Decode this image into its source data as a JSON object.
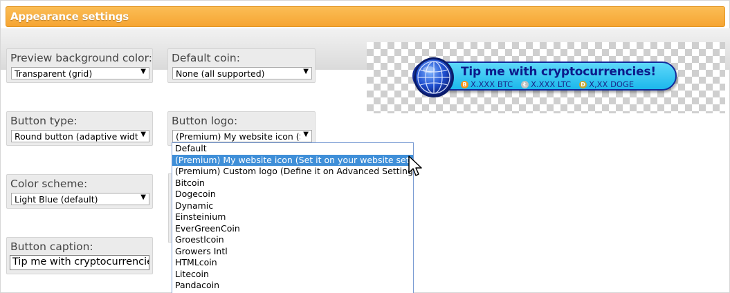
{
  "header": {
    "title": "Appearance settings"
  },
  "fields": {
    "preview_bg": {
      "label": "Preview background color:",
      "value": "Transparent (grid)"
    },
    "default_coin": {
      "label": "Default coin:",
      "value": "None (all supported)"
    },
    "button_type": {
      "label": "Button type:",
      "value": "Round button (adaptive width)"
    },
    "button_logo": {
      "label": "Button logo:",
      "value": "(Premium) My website icon (S"
    },
    "color_scheme": {
      "label": "Color scheme:",
      "value": "Light Blue (default)"
    },
    "button_caption": {
      "label": "Button caption:",
      "value": "Tip me with cryptocurrencies"
    }
  },
  "preview": {
    "title": "Tip me with cryptocurrencies!",
    "coins": [
      {
        "label": "X.XXX BTC",
        "icon": "bitcoin-icon",
        "color": "#f7931a"
      },
      {
        "label": "X.XXX LTC",
        "icon": "litecoin-icon",
        "color": "#bfbfbf"
      },
      {
        "label": "X,XX DOGE",
        "icon": "dogecoin-icon",
        "color": "#c2a633"
      }
    ]
  },
  "dropdown": {
    "items": [
      "Default",
      "(Premium) My website icon (Set it on your website settings)",
      "(Premium) Custom logo (Define it on Advanced Settings)",
      "Bitcoin",
      "Dogecoin",
      "Dynamic",
      "Einsteinium",
      "EverGreenCoin",
      "Groestlcoin",
      "Growers Intl",
      "HTMLcoin",
      "Litecoin",
      "Pandacoin"
    ],
    "selected_index": 1
  },
  "colors": {
    "header": "#f6a533",
    "accent": "#3f8fd8",
    "button": "#1cb8ec"
  }
}
